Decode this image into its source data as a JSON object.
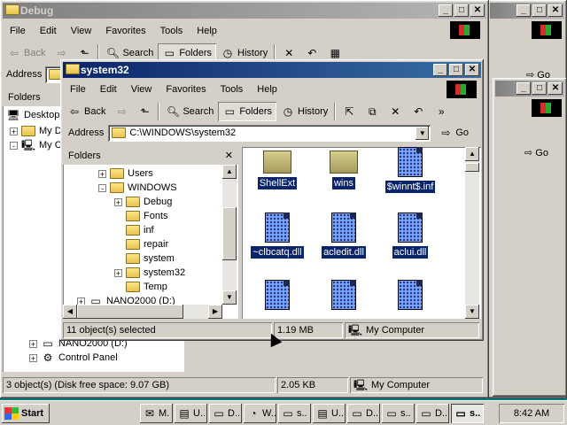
{
  "bg_window": {
    "title": "Debug",
    "menu": [
      "File",
      "Edit",
      "View",
      "Favorites",
      "Tools",
      "Help"
    ],
    "toolbar": {
      "back": "Back",
      "search": "Search",
      "folders": "Folders",
      "history": "History"
    },
    "address_label": "Address",
    "folders_header": "Folders",
    "tree": [
      "Desktop",
      "My D",
      "My C",
      "NANO2000 (D:)",
      "Control Panel"
    ],
    "status": {
      "objects": "3 object(s) (Disk free space: 9.07 GB)",
      "size": "2.05 KB",
      "zone": "My Computer"
    }
  },
  "right_windows": {
    "go": "Go",
    "status_tail": "er"
  },
  "main_window": {
    "title": "system32",
    "menu": [
      "File",
      "Edit",
      "View",
      "Favorites",
      "Tools",
      "Help"
    ],
    "toolbar": {
      "back": "Back",
      "search": "Search",
      "folders": "Folders",
      "history": "History"
    },
    "address_label": "Address",
    "address_value": "C:\\WINDOWS\\system32",
    "go": "Go",
    "folders_header": "Folders",
    "tree": [
      {
        "label": "Users",
        "expander": "+"
      },
      {
        "label": "WINDOWS",
        "expander": "-"
      },
      {
        "label": "Debug",
        "expander": "+"
      },
      {
        "label": "Fonts",
        "expander": ""
      },
      {
        "label": "inf",
        "expander": ""
      },
      {
        "label": "repair",
        "expander": ""
      },
      {
        "label": "system",
        "expander": ""
      },
      {
        "label": "system32",
        "expander": "+"
      },
      {
        "label": "Temp",
        "expander": ""
      },
      {
        "label": "NANO2000 (D:)",
        "expander": "+"
      }
    ],
    "files": [
      {
        "name": "ShellExt",
        "type": "folder"
      },
      {
        "name": "wins",
        "type": "folder"
      },
      {
        "name": "$winnt$.inf",
        "type": "doc"
      },
      {
        "name": "~clbcatq.dll",
        "type": "doc"
      },
      {
        "name": "acledit.dll",
        "type": "doc"
      },
      {
        "name": "aclui.dll",
        "type": "doc"
      }
    ],
    "status": {
      "selected": "11 object(s) selected",
      "size": "1.19 MB",
      "zone": "My Computer"
    }
  },
  "taskbar": {
    "start": "Start",
    "buttons": [
      "M.",
      "U..",
      "D..",
      "W..",
      "s..",
      "U..",
      "D..",
      "s..",
      "D..",
      "s.."
    ],
    "active_index": 9,
    "clock": "8:42 AM"
  }
}
